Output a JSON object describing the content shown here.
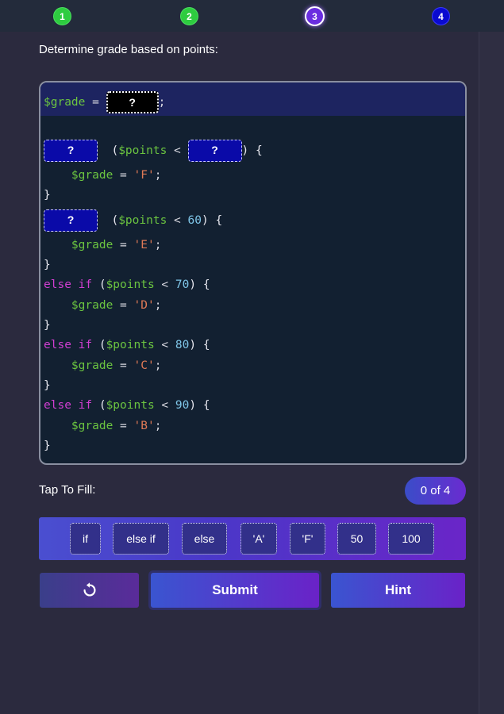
{
  "steps": [
    {
      "label": "1",
      "state": "done"
    },
    {
      "label": "2",
      "state": "done"
    },
    {
      "label": "3",
      "state": "current"
    },
    {
      "label": "4",
      "state": "todo"
    }
  ],
  "prompt": "Determine grade based on points:",
  "code": {
    "line1": {
      "var": "$grade",
      "eq": "=",
      "slot": "?",
      "end": ";"
    },
    "line2": {
      "slot1": "?",
      "cond_open": "($points <",
      "slot2": "?",
      "cond_close": ") {"
    },
    "line3": {
      "var": "$grade",
      "eq": "=",
      "str": "'F'",
      "end": ";"
    },
    "line4": "}",
    "line5": {
      "slot": "?",
      "cond_a": "($points <",
      "num": "60",
      "cond_b": ") {"
    },
    "line6": {
      "var": "$grade",
      "eq": "=",
      "str": "'E'",
      "end": ";"
    },
    "line7": "}",
    "line8": {
      "kw": "else if",
      "cond_a": "($points <",
      "num": "70",
      "cond_b": ") {"
    },
    "line9": {
      "var": "$grade",
      "eq": "=",
      "str": "'D'",
      "end": ";"
    },
    "line10": "}",
    "line11": {
      "kw": "else if",
      "cond_a": "($points <",
      "num": "80",
      "cond_b": ") {"
    },
    "line12": {
      "var": "$grade",
      "eq": "=",
      "str": "'C'",
      "end": ";"
    },
    "line13": "}",
    "line14": {
      "kw": "else if",
      "cond_a": "($points <",
      "num": "90",
      "cond_b": ") {"
    },
    "line15": {
      "var": "$grade",
      "eq": "=",
      "str": "'B'",
      "end": ";"
    },
    "line16": "}"
  },
  "fill_label": "Tap To Fill:",
  "progress_text": "0 of 4",
  "choices": [
    "if",
    "else if",
    "else",
    "'A'",
    "'F'",
    "50",
    "100"
  ],
  "buttons": {
    "undo_icon": "undo-icon",
    "submit": "Submit",
    "hint": "Hint"
  },
  "colors": {
    "accent_purple": "#6a22c8",
    "accent_blue": "#3a55d0",
    "step_done": "#2ecc40",
    "step_todo": "#0a0ad0"
  }
}
